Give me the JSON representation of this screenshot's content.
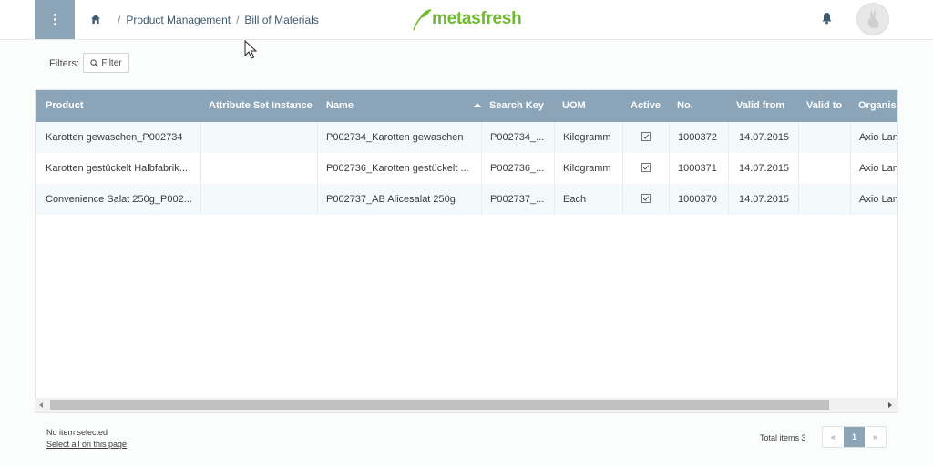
{
  "header": {
    "breadcrumb": [
      {
        "sep": "/",
        "label": "Product Management"
      },
      {
        "sep": "/",
        "label": "Bill of Materials"
      }
    ],
    "logo_text": "metasfresh"
  },
  "filters": {
    "label": "Filters:",
    "button_label": "Filter"
  },
  "table": {
    "columns": [
      "Product",
      "Attribute Set Instance",
      "Name",
      "Search Key",
      "UOM",
      "Active",
      "No.",
      "Valid from",
      "Valid to",
      "Organisa"
    ],
    "sorted_column": "Name",
    "sort_direction": "ascending",
    "rows": [
      {
        "product": "Karotten gewaschen_P002734",
        "asi": "",
        "name": "P002734_Karotten gewaschen",
        "search_key": "P002734_...",
        "uom": "Kilogramm",
        "active": true,
        "no": "1000372",
        "valid_from": "14.07.2015",
        "valid_to": "",
        "org": "Axio Lan"
      },
      {
        "product": "Karotten gestückelt Halbfabrik...",
        "asi": "",
        "name": "P002736_Karotten gestückelt ...",
        "search_key": "P002736_...",
        "uom": "Kilogramm",
        "active": true,
        "no": "1000371",
        "valid_from": "14.07.2015",
        "valid_to": "",
        "org": "Axio Lan"
      },
      {
        "product": "Convenience Salat 250g_P002...",
        "asi": "",
        "name": "P002737_AB Alicesalat 250g",
        "search_key": "P002737_...",
        "uom": "Each",
        "active": true,
        "no": "1000370",
        "valid_from": "14.07.2015",
        "valid_to": "",
        "org": "Axio Lan"
      }
    ]
  },
  "footer": {
    "selection": "No item selected",
    "select_all": "Select all on this page",
    "total": "Total items 3",
    "pager": {
      "prev": "«",
      "current": "1",
      "next": "»"
    }
  },
  "colors": {
    "header_bar": "#8ba4b8",
    "brand_green": "#6fba2f"
  }
}
